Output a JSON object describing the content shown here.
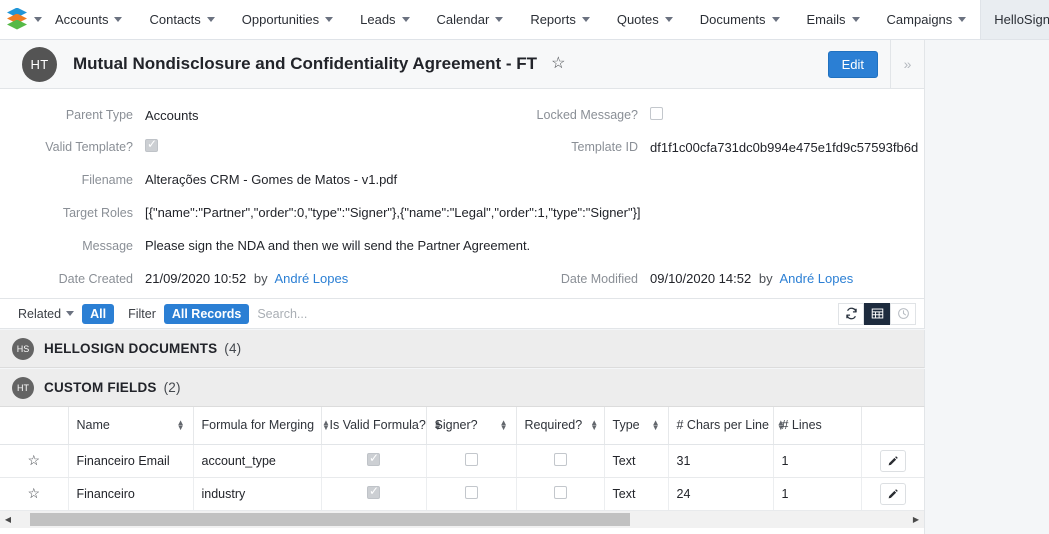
{
  "topnav": {
    "logo_icon": "suitecrm-layers-logo",
    "logo_caret_icon": "chevron-down-icon",
    "items": [
      {
        "label": "Accounts",
        "icon": "chevron-down-icon"
      },
      {
        "label": "Contacts",
        "icon": "chevron-down-icon"
      },
      {
        "label": "Opportunities",
        "icon": "chevron-down-icon"
      },
      {
        "label": "Leads",
        "icon": "chevron-down-icon"
      },
      {
        "label": "Calendar",
        "icon": "chevron-down-icon"
      },
      {
        "label": "Reports",
        "icon": "chevron-down-icon"
      },
      {
        "label": "Quotes",
        "icon": "chevron-down-icon"
      },
      {
        "label": "Documents",
        "icon": "chevron-down-icon"
      },
      {
        "label": "Emails",
        "icon": "chevron-down-icon"
      },
      {
        "label": "Campaigns",
        "icon": "chevron-down-icon"
      },
      {
        "label": "HelloSign Templates",
        "icon": "chevron-down-icon",
        "active": true
      }
    ]
  },
  "record": {
    "avatar_initials": "HT",
    "title": "Mutual Nondisclosure and Confidentiality Agreement - FT",
    "favorite_icon": "star-outline-icon",
    "edit_label": "Edit",
    "more_icon": "double-chevron-right-icon"
  },
  "detail": {
    "parent_type_label": "Parent Type",
    "parent_type_value": "Accounts",
    "locked_message_label": "Locked Message?",
    "locked_message_checked": false,
    "valid_template_label": "Valid Template?",
    "valid_template_checked": true,
    "template_id_label": "Template ID",
    "template_id_value": "df1f1c00cfa731dc0b994e475e1fd9c57593fb6d",
    "filename_label": "Filename",
    "filename_value": "Alterações CRM - Gomes de Matos - v1.pdf",
    "target_roles_label": "Target Roles",
    "target_roles_value": "[{\"name\":\"Partner\",\"order\":0,\"type\":\"Signer\"},{\"name\":\"Legal\",\"order\":1,\"type\":\"Signer\"}]",
    "message_label": "Message",
    "message_value": "Please sign the NDA and then we will send the Partner Agreement.",
    "date_created_label": "Date Created",
    "date_created_value": "21/09/2020 10:52",
    "date_created_by": "by",
    "date_created_user": "André Lopes",
    "date_modified_label": "Date Modified",
    "date_modified_value": "09/10/2020 14:52",
    "date_modified_by": "by",
    "date_modified_user": "André Lopes"
  },
  "toolbar": {
    "related_label": "Related",
    "related_caret_icon": "caret-down-icon",
    "all_label": "All",
    "filter_label": "Filter",
    "all_records_label": "All Records",
    "search_placeholder": "Search...",
    "search_value": "",
    "refresh_icon": "refresh-icon",
    "grid_icon": "grid-view-icon",
    "clock_icon": "clock-icon"
  },
  "sections": [
    {
      "avatar": "HS",
      "title": "HELLOSIGN DOCUMENTS",
      "count": "(4)"
    },
    {
      "avatar": "HT",
      "title": "CUSTOM FIELDS",
      "count": "(2)"
    }
  ],
  "table": {
    "columns": [
      {
        "label": "",
        "sortable": false
      },
      {
        "label": "Name",
        "sortable": true
      },
      {
        "label": "Formula for Merging",
        "sortable": true
      },
      {
        "label": "Is Valid Formula?",
        "sortable": true
      },
      {
        "label": "Signer?",
        "sortable": true
      },
      {
        "label": "Required?",
        "sortable": true
      },
      {
        "label": "Type",
        "sortable": true
      },
      {
        "label": "# Chars per Line",
        "sortable": true
      },
      {
        "label": "# Lines",
        "sortable": false
      },
      {
        "label": "",
        "sortable": false
      }
    ],
    "rows": [
      {
        "star_icon": "star-outline-icon",
        "name": "Financeiro Email",
        "formula": "account_type",
        "is_valid_formula": true,
        "signer": false,
        "required": false,
        "type": "Text",
        "chars_per_line": "31",
        "lines": "1",
        "edit_icon": "pencil-icon"
      },
      {
        "star_icon": "star-outline-icon",
        "name": "Financeiro",
        "formula": "industry",
        "is_valid_formula": true,
        "signer": false,
        "required": false,
        "type": "Text",
        "chars_per_line": "24",
        "lines": "1",
        "edit_icon": "pencil-icon"
      }
    ]
  },
  "scrollbar": {
    "left_arrow_icon": "triangle-left-icon",
    "right_arrow_icon": "triangle-right-icon"
  },
  "colors": {
    "accent": "#2b7fd4",
    "dark_button": "#1d2b3e",
    "avatar": "#545454"
  }
}
